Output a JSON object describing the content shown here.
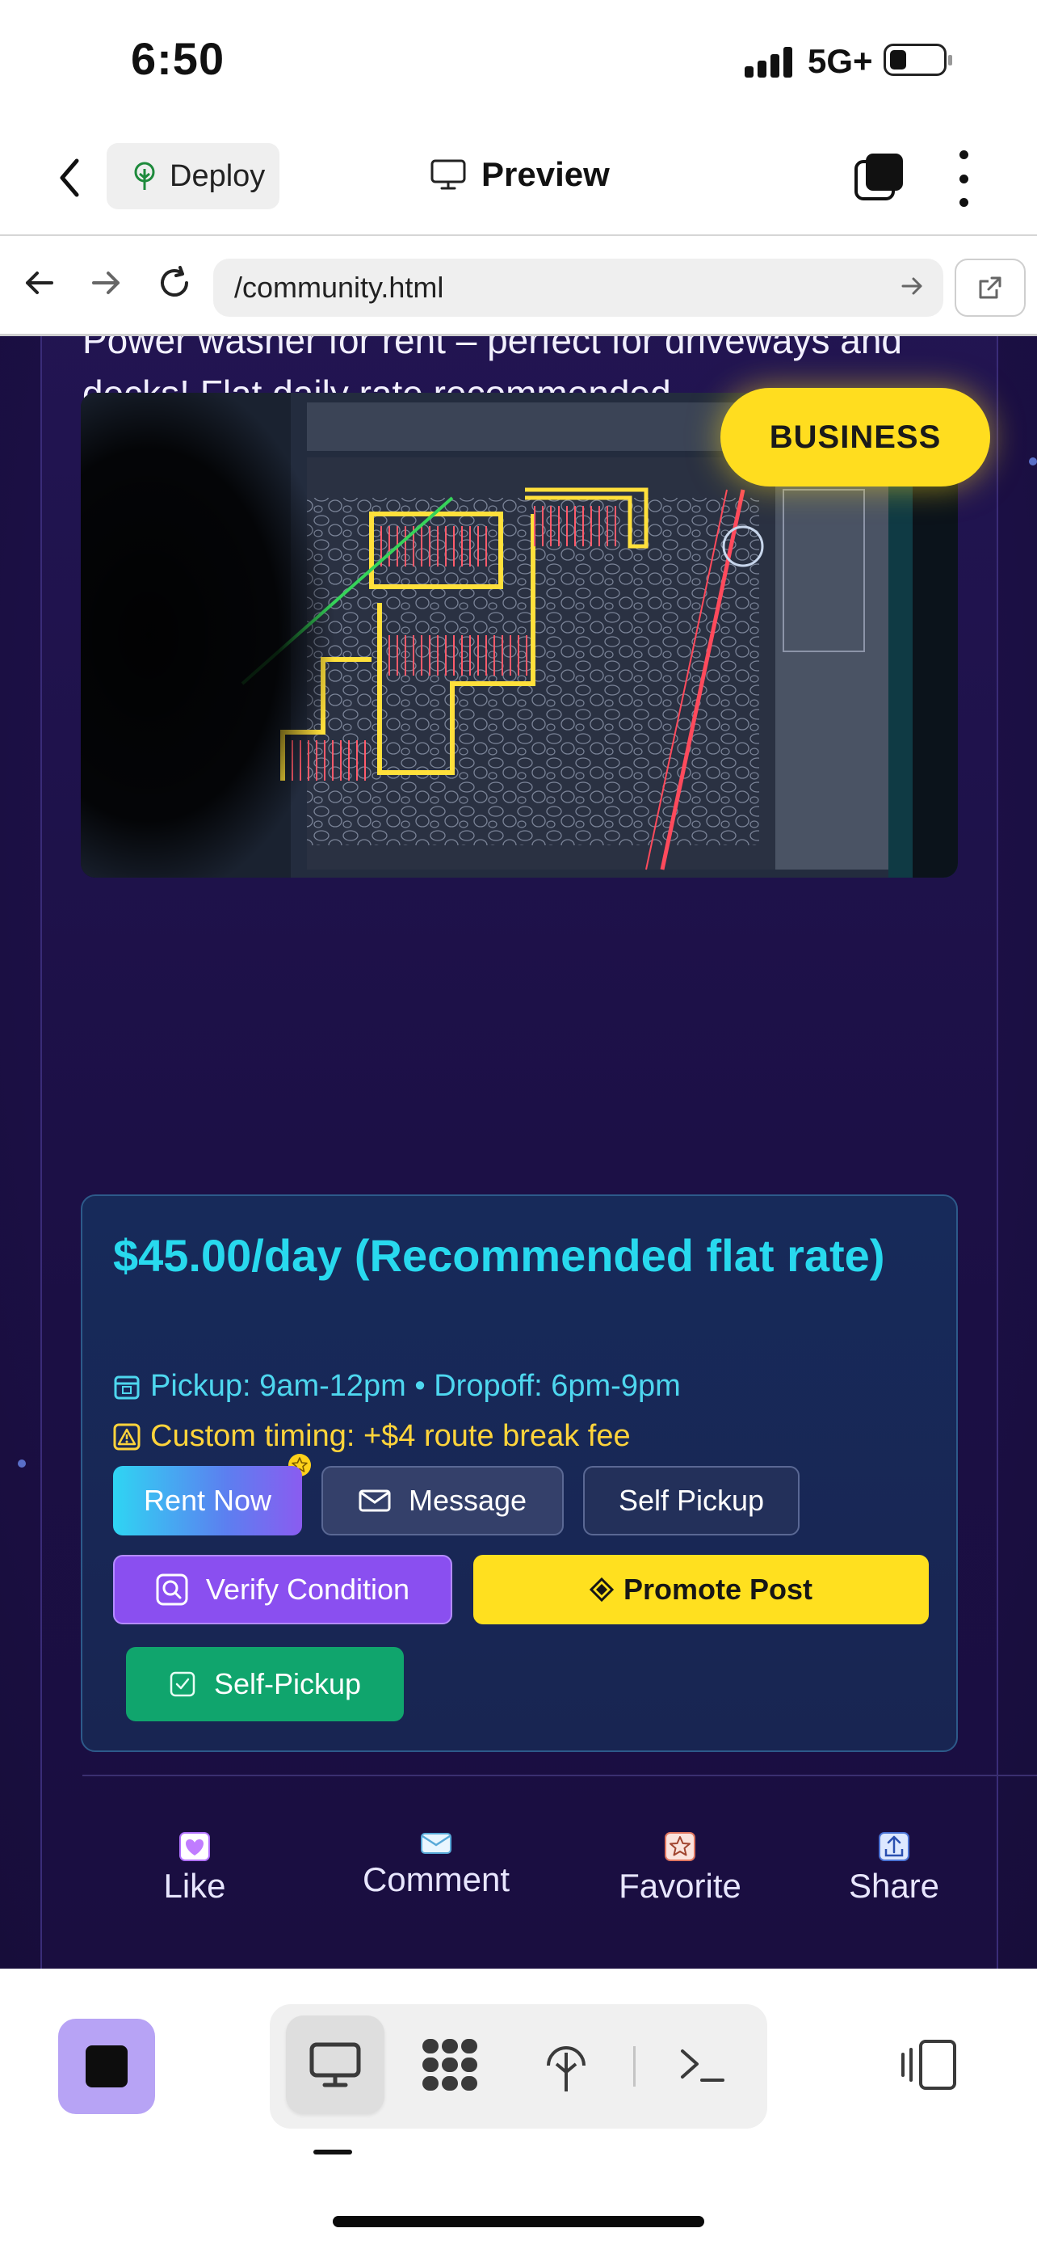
{
  "status_bar": {
    "time": "6:50",
    "network": "5G+"
  },
  "app_bar": {
    "deploy_label": "Deploy",
    "title": "Preview"
  },
  "browser": {
    "url": "/community.html"
  },
  "post": {
    "description": "Power washer for rent – perfect for driveways and decks! Flat daily rate recommended.",
    "badge": "BUSINESS",
    "price": "$45.00/day (Recommended flat rate)",
    "pickup_info": "Pickup: 9am-12pm • Dropoff: 6pm-9pm",
    "custom_timing": "Custom timing: +$4 route break fee",
    "buttons": {
      "rent_now": "Rent Now",
      "message": "Message",
      "self_pickup": "Self Pickup",
      "verify_condition": "Verify Condition",
      "promote_post": "Promote Post",
      "self_pickup_alt": "Self-Pickup"
    },
    "actions": {
      "like": "Like",
      "comment": "Comment",
      "favorite": "Favorite",
      "share": "Share"
    }
  },
  "colors": {
    "page_bg": "#1d1048",
    "price_text": "#28d9ee",
    "warning_text": "#ffd43b",
    "badge_yellow": "#ffdd1f",
    "verify_purple": "#8a4ff0",
    "selfpickup_green": "#10a56d",
    "stop_button": "#b7a3f5"
  },
  "icons": {
    "deploy": "tree-icon",
    "preview": "monitor-icon",
    "pickup": "calendar-icon",
    "custom_timing": "warning-icon",
    "message": "envelope-icon",
    "verify": "search-icon",
    "promote": "diamond-icon",
    "self_pickup": "checkbox-icon",
    "like": "heart-icon",
    "comment": "envelope-icon",
    "favorite": "star-icon",
    "share": "share-icon"
  }
}
